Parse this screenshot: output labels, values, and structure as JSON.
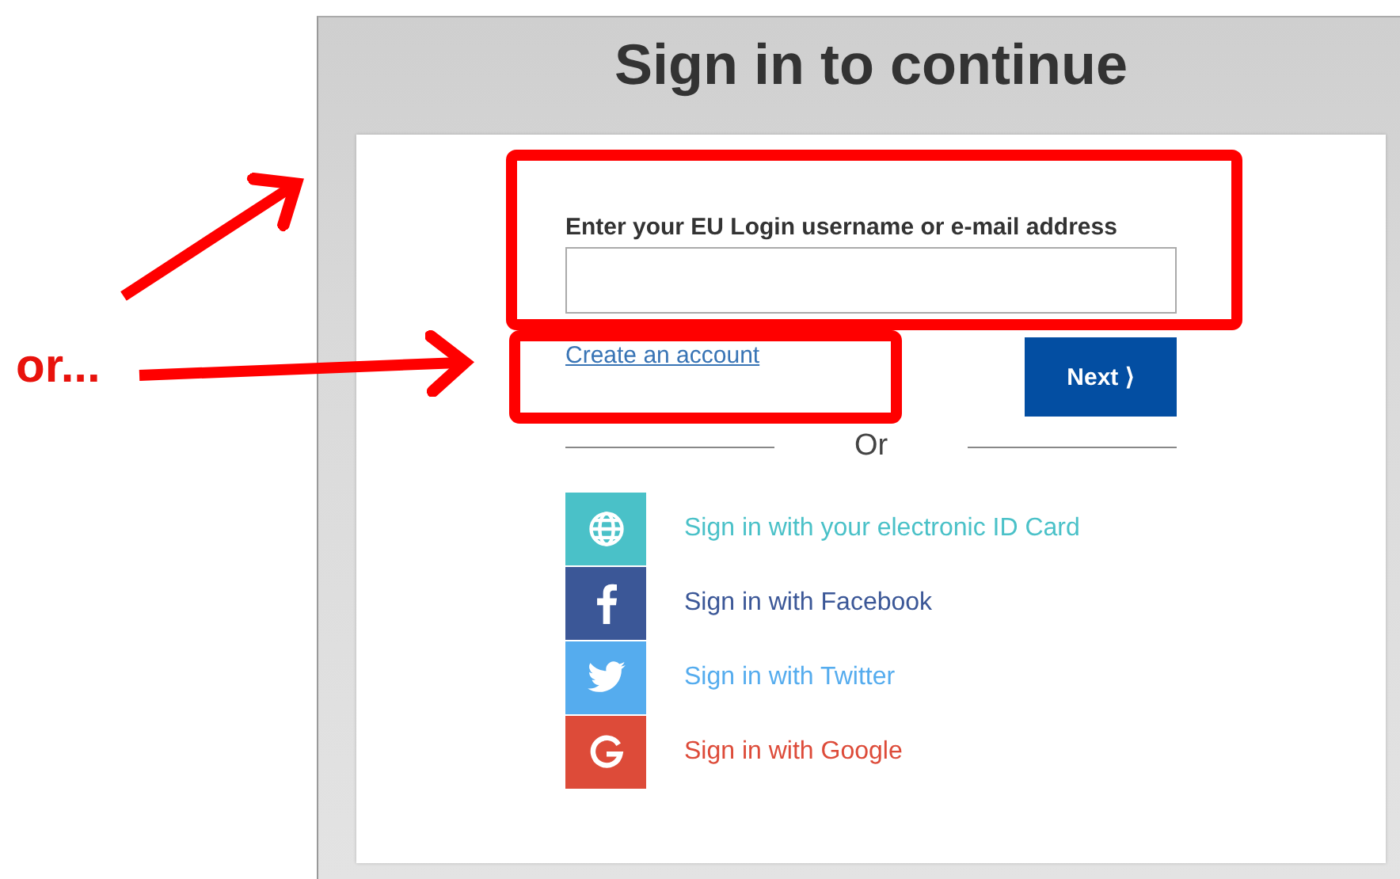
{
  "annotation": {
    "note": "or..."
  },
  "title": "Sign in to continue",
  "login": {
    "label": "Enter your EU Login username or e-mail address",
    "create_account": "Create an account",
    "next_button": "Next ⟩"
  },
  "divider": "Or",
  "providers": [
    {
      "kind": "globe",
      "label": "Sign in with your electronic ID Card",
      "color": "#4ac1c8"
    },
    {
      "kind": "facebook",
      "label": "Sign in with Facebook",
      "color": "#3b5797"
    },
    {
      "kind": "twitter",
      "label": "Sign in with Twitter",
      "color": "#55acee"
    },
    {
      "kind": "google",
      "label": "Sign in with Google",
      "color": "#dd4b39"
    }
  ]
}
